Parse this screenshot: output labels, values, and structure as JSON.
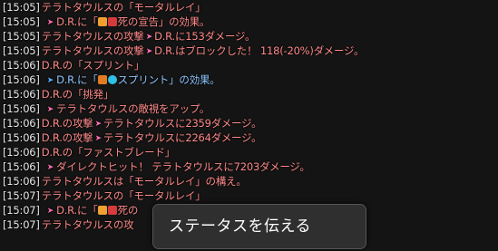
{
  "chat_log": {
    "lines": [
      {
        "time": "[15:05]",
        "text": "テラトタウルスの「モータルレイ」"
      },
      {
        "time": "[15:05]",
        "pre": "D.R.に「",
        "icon_name": "status-effect-icon",
        "text": "死の宣告」の効果。"
      },
      {
        "time": "[15:05]",
        "text": "テラトタウルスの攻撃",
        "post": "D.R.に153ダメージ。"
      },
      {
        "time": "[15:05]",
        "text": "テラトタウルスの攻撃",
        "post": "D.R.はブロックした！ 118(-20%)ダメージ。"
      },
      {
        "time": "[15:06]",
        "text": "D.R.の「スプリント」"
      },
      {
        "time": "[15:06]",
        "pre": "D.R.に「",
        "icon_name": "sprint-status-icon",
        "text": "スプリント」の効果。"
      },
      {
        "time": "[15:06]",
        "text": "D.R.の「挑発」"
      },
      {
        "time": "[15:06]",
        "text": "テラトタウルスの敵視をアップ。"
      },
      {
        "time": "[15:06]",
        "text": "D.R.の攻撃",
        "post": "テラトタウルスに2359ダメージ。"
      },
      {
        "time": "[15:06]",
        "text": "D.R.の攻撃",
        "post": "テラトタウルスに2264ダメージ。"
      },
      {
        "time": "[15:06]",
        "text": "D.R.の「ファストブレード」"
      },
      {
        "time": "[15:06]",
        "text": "ダイレクトヒット！ テラトタウルスに7203ダメージ。"
      },
      {
        "time": "[15:06]",
        "text": "テラトタウルスは「モータルレイ」の構え。"
      },
      {
        "time": "[15:07]",
        "text": "テラトタウルスの「モータルレイ」"
      },
      {
        "time": "[15:07]",
        "pre": "D.R.に「",
        "icon_name": "status-effect-icon",
        "text": "死の"
      },
      {
        "time": "[15:07]",
        "text": "テラトタウルスの攻"
      }
    ]
  },
  "tooltip": {
    "label": "ステータスを伝える"
  },
  "colors": {
    "damage_text": "#ff8a8a",
    "buff_text": "#8fc6ff",
    "timestamp": "#e9e9e9",
    "background": "#141414",
    "tooltip_bg": "#2f2f2f"
  }
}
